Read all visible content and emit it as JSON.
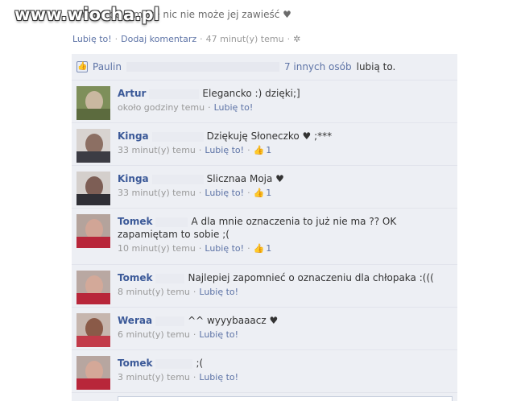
{
  "watermark": "www.wiocha.pl",
  "post": {
    "text": "...mają po tym, że nic nie może jej zawieść ♥",
    "like_label": "Lubię to!",
    "comment_label": "Dodaj komentarz",
    "time": "47 minut(y) temu"
  },
  "likes": {
    "first_name": "Paulin",
    "others_link": "7 innych osób",
    "suffix": "lubią to."
  },
  "comments": [
    {
      "author": "Artur",
      "text": "Elegancko :) dzięki;]",
      "time": "około godziny temu",
      "like_label": "Lubię to!",
      "likes": ""
    },
    {
      "author": "Kinga",
      "text": "Dziękuję Słoneczko ♥ ;***",
      "time": "33 minut(y) temu",
      "like_label": "Lubię to!",
      "likes": "1"
    },
    {
      "author": "Kinga",
      "text": "Slicznaa Moja ♥",
      "time": "33 minut(y) temu",
      "like_label": "Lubię to!",
      "likes": "1"
    },
    {
      "author": "Tomek",
      "text": "A dla mnie oznaczenia to już nie ma ?? OK",
      "text2": "zapamiętam to sobie ;(",
      "time": "10 minut(y) temu",
      "like_label": "Lubię to!",
      "likes": "1"
    },
    {
      "author": "Tomek",
      "text": "Najlepiej zapomnieć o oznaczeniu dla chłopaka :(((",
      "time": "8 minut(y) temu",
      "like_label": "Lubię to!",
      "likes": ""
    },
    {
      "author": "Weraa",
      "text": "^^ wyyybaaacz ♥",
      "time": "6 minut(y) temu",
      "like_label": "Lubię to!",
      "likes": ""
    },
    {
      "author": "Tomek",
      "text": ";(",
      "time": "3 minut(y) temu",
      "like_label": "Lubię to!",
      "likes": ""
    }
  ],
  "colors": {
    "link": "#5d73a6",
    "author": "#3b5998",
    "panel": "#edeff4"
  },
  "icons": {
    "like": "thumbs-up-icon",
    "settings": "gear-icon"
  }
}
